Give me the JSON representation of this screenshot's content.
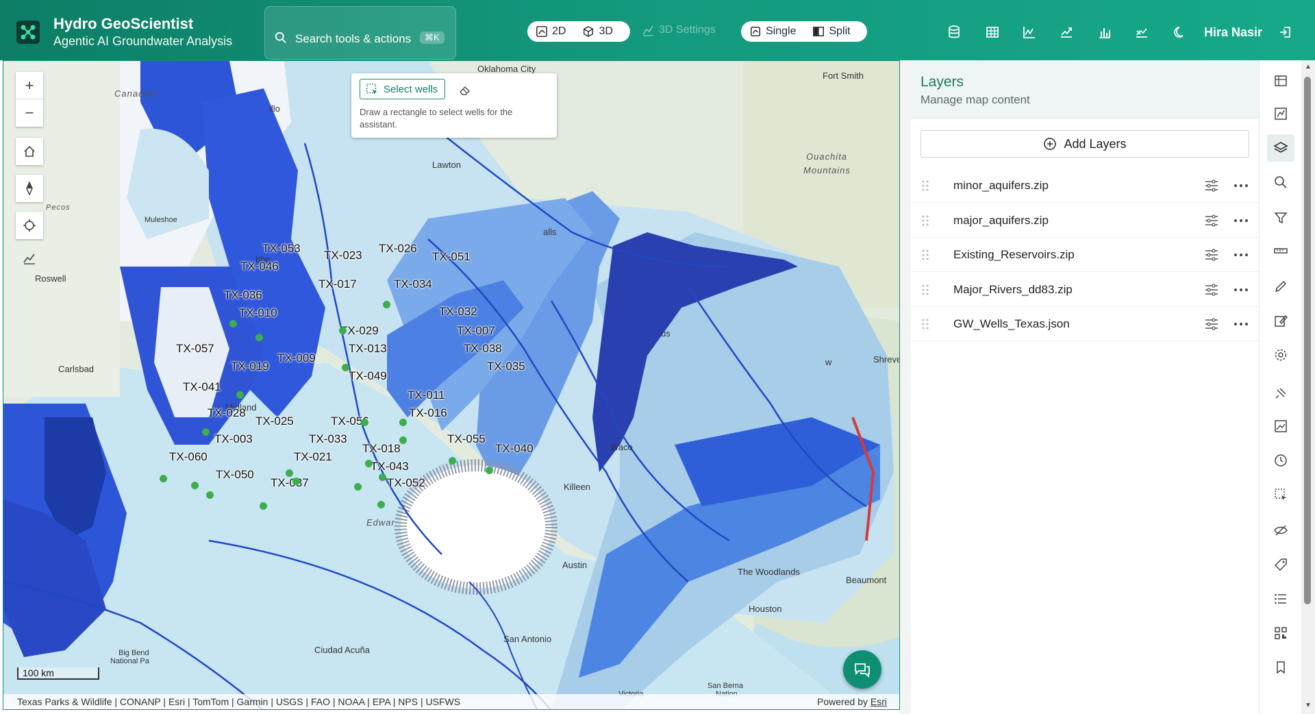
{
  "header": {
    "title": "Hydro GeoScientist",
    "subtitle": "Agentic AI Groundwater Analysis",
    "search_label": "Search tools & actions",
    "search_shortcut": "⌘K",
    "view_2d": "2D",
    "view_3d": "3D",
    "settings_3d": "3D Settings",
    "single": "Single",
    "split": "Split",
    "user_name": "Hira Nasir",
    "icons": [
      "database-icon",
      "table-icon",
      "line-chart-icon",
      "trend-chart-icon",
      "bar-chart-icon",
      "scatter-chart-icon",
      "moon-icon",
      "logout-icon"
    ]
  },
  "map": {
    "select_wells_label": "Select wells",
    "select_hint": "Draw a rectangle to select wells for the assistant.",
    "scale": "100 km",
    "attribution": "Texas Parks & Wildlife | CONANP | Esri | TomTom | Garmin | USGS | FAO | NOAA | EPA | NPS | USFWS",
    "powered_by": "Powered by",
    "powered_by_link": "Esri",
    "places": {
      "oklahoma_city": "Oklahoma City",
      "fort_smith": "Fort Smith",
      "lawton": "Lawton",
      "ouachita_1": "Ouachita",
      "ouachita_2": "Mountains",
      "roswell": "Roswell",
      "carlsbad": "Carlsbad",
      "waco": "Waco",
      "killeen": "Killeen",
      "austin": "Austin",
      "san_antonio": "San Antonio",
      "the_woodlands": "The Woodlands",
      "houston": "Houston",
      "beaumont": "Beaumont",
      "ciudad_acuna": "Ciudad Acuña",
      "big_bend_1": "Big Bend",
      "big_bend_2": "National Pa",
      "shreveport": "Shreve",
      "midland": "Midland",
      "canadian": "Canadian",
      "pecos": "Pecos",
      "falls": "alls",
      "victoria": "Victoria",
      "san_bernard": "San Berna",
      "san_bernard_2": "Nation",
      "mulesho": "Muleshoe",
      "bbo": "bbo",
      "illo": "illo",
      "edwards": "Edwar",
      "us": "us",
      "w": "w"
    },
    "wells": [
      "TX-053",
      "TX-023",
      "TX-026",
      "TX-051",
      "TX-046",
      "TX-017",
      "TX-034",
      "TX-036",
      "TX-010",
      "TX-032",
      "TX-029",
      "TX-007",
      "TX-013",
      "TX-038",
      "TX-057",
      "TX-009",
      "TX-035",
      "TX-019",
      "TX-049",
      "TX-041",
      "TX-011",
      "TX-016",
      "TX-028",
      "TX-025",
      "TX-056",
      "TX-055",
      "TX-003",
      "TX-033",
      "TX-018",
      "TX-040",
      "TX-060",
      "TX-021",
      "TX-043",
      "TX-050",
      "TX-037",
      "TX-052"
    ]
  },
  "layers_panel": {
    "title": "Layers",
    "subtitle": "Manage map content",
    "add_label": "Add Layers",
    "layers": [
      {
        "name": "minor_aquifers.zip"
      },
      {
        "name": "major_aquifers.zip"
      },
      {
        "name": "Existing_Reservoirs.zip"
      },
      {
        "name": "Major_Rivers_dd83.zip"
      },
      {
        "name": "GW_Wells_Texas.json"
      }
    ]
  },
  "rail": {
    "icons": [
      "basemap-icon",
      "chart-panel-icon",
      "layers-icon",
      "search-icon",
      "filter-icon",
      "measure-icon",
      "draw-icon",
      "edit-icon",
      "settings-icon",
      "pin-icon",
      "image-icon",
      "history-icon",
      "select-icon",
      "eye-off-icon",
      "tag-icon",
      "list-icon",
      "qr-icon",
      "bookmark-icon"
    ],
    "active": "layers-icon"
  },
  "colors": {
    "header": "#13987c",
    "accent": "#0e8f74",
    "aquifer_dark": "#2c44c4",
    "aquifer_mid": "#6fa3ea",
    "aquifer_light": "#b8dbf0",
    "well_dot": "#3cae4e"
  }
}
